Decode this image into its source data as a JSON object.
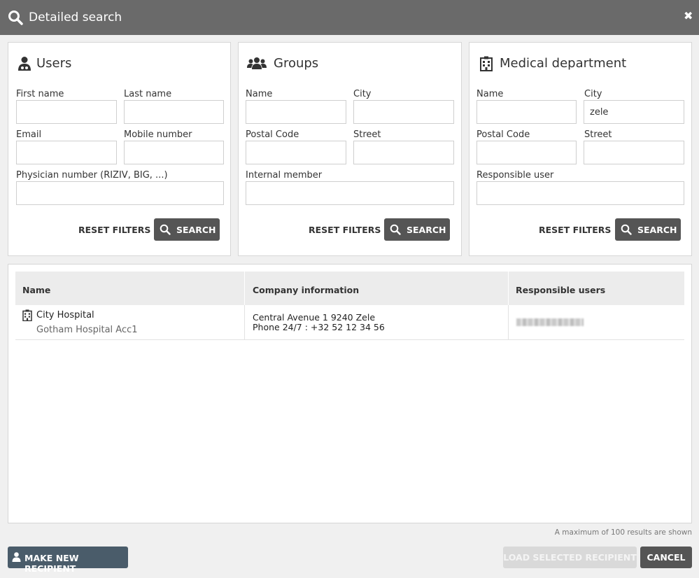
{
  "dialog": {
    "title": "Detailed search",
    "close_glyph": "✖"
  },
  "users": {
    "title": "Users",
    "first_name_label": "First name",
    "last_name_label": "Last name",
    "email_label": "Email",
    "mobile_label": "Mobile number",
    "physician_label": "Physician number (RIZIV, BIG, ...)",
    "first_name_value": "",
    "last_name_value": "",
    "email_value": "",
    "mobile_value": "",
    "physician_value": "",
    "reset_label": "RESET FILTERS",
    "search_label": "SEARCH"
  },
  "groups": {
    "title": "Groups",
    "name_label": "Name",
    "city_label": "City",
    "postal_label": "Postal Code",
    "street_label": "Street",
    "internal_label": "Internal member",
    "name_value": "",
    "city_value": "",
    "postal_value": "",
    "street_value": "",
    "internal_value": "",
    "reset_label": "RESET FILTERS",
    "search_label": "SEARCH"
  },
  "medical": {
    "title": "Medical department",
    "name_label": "Name",
    "city_label": "City",
    "postal_label": "Postal Code",
    "street_label": "Street",
    "responsible_label": "Responsible user",
    "name_value": "",
    "city_value": "zele",
    "postal_value": "",
    "street_value": "",
    "responsible_value": "",
    "reset_label": "RESET FILTERS",
    "search_label": "SEARCH"
  },
  "results": {
    "columns": [
      "Name",
      "Company information",
      "Responsible users"
    ],
    "rows": [
      {
        "name": "City Hospital",
        "subname": "Gotham Hospital Acc1",
        "address": "Central Avenue 1 9240 Zele",
        "phone": "Phone 24/7 : +32 52 12 34 56"
      }
    ],
    "max_note": "A maximum of 100 results are shown"
  },
  "footer": {
    "new_label": "MAKE NEW RECIPIENT",
    "load_label": "LOAD SELECTED RECIPIENT",
    "cancel_label": "CANCEL"
  },
  "colors": {
    "titlebar": "#6a6a6a",
    "search_button": "#555555",
    "new_button": "#4a5c6a",
    "disabled_button": "#d9d9d9"
  },
  "icons": [
    "search-icon",
    "close-icon",
    "user-doctor-icon",
    "users-group-icon",
    "hospital-icon",
    "user-icon"
  ]
}
